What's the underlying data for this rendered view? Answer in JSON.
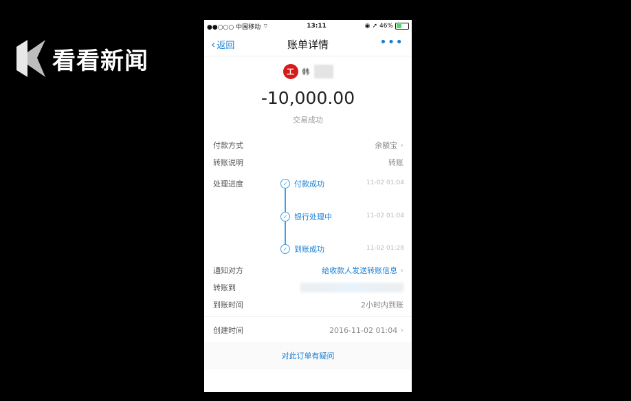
{
  "watermark": {
    "text": "看看新闻"
  },
  "statusbar": {
    "carrier": "●●○○○ 中国移动",
    "time": "13:11",
    "battery": "46%",
    "battery_level": 0.46
  },
  "nav": {
    "back_label": "返回",
    "title": "账单详情",
    "more": "•••"
  },
  "payee": {
    "bank_icon": "工",
    "name": "韩"
  },
  "amount": "-10,000.00",
  "status": "交易成功",
  "rows": {
    "payment_method": {
      "label": "付款方式",
      "value": "余额宝"
    },
    "transfer_note": {
      "label": "转账说明",
      "value": "转账"
    },
    "progress": {
      "label": "处理进度"
    },
    "notify": {
      "label": "通知对方",
      "value": "给收款人发送转账信息"
    },
    "transfer_to": {
      "label": "转账到"
    },
    "arrival_time": {
      "label": "到账时间",
      "value": "2小时内到账"
    },
    "created_time": {
      "label": "创建时间",
      "value": "2016-11-02 01:04"
    }
  },
  "progress_steps": [
    {
      "label": "付款成功",
      "time": "11-02 01:04"
    },
    {
      "label": "银行处理中",
      "time": "11-02 01:04"
    },
    {
      "label": "到账成功",
      "time": "11-02 01:28"
    }
  ],
  "footer": {
    "question_link": "对此订单有疑问"
  }
}
